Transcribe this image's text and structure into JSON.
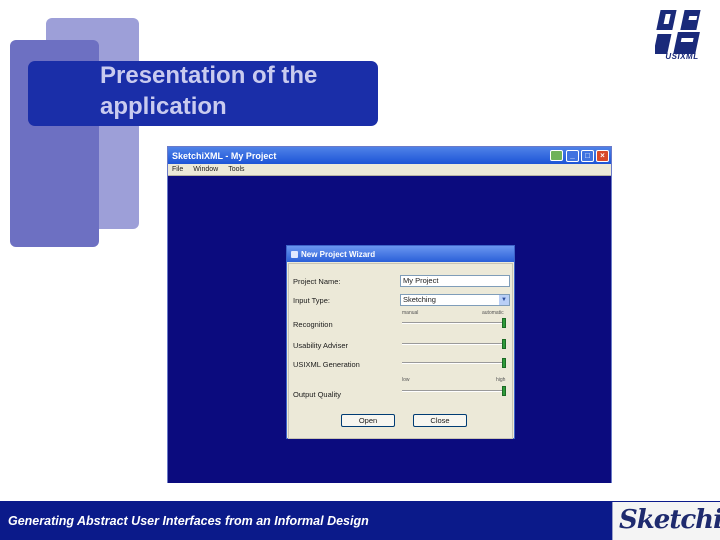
{
  "slide": {
    "title": "Presentation of the application",
    "footer": "Generating Abstract User Interfaces from an Informal Design",
    "logo_top_text": "USIXML",
    "logo_bottom_text": "Sketchi",
    "colors": {
      "title_band": "#1a2ea8",
      "footer": "#0b1a8a",
      "canvas": "#0b0b7e"
    }
  },
  "app": {
    "window_title": "SketchiXML - My Project",
    "menu": [
      "File",
      "Window",
      "Tools"
    ]
  },
  "wizard": {
    "title": "New Project Wizard",
    "fields": {
      "project_name_label": "Project Name:",
      "project_name_value": "My Project",
      "input_type_label": "Input Type:",
      "input_type_value": "Sketching",
      "recognition_label": "Recognition",
      "usability_label": "Usability Adviser",
      "usixml_label": "USIXML Generation",
      "output_label": "Output Quality"
    },
    "slider_ticks": {
      "manual": "manual",
      "automatic": "automatic",
      "low": "low",
      "high": "high"
    },
    "sliders": {
      "recognition": 1.0,
      "usability": 1.0,
      "usixml": 1.0,
      "output_quality": 1.0
    },
    "buttons": {
      "ok": "Open",
      "cancel": "Close"
    }
  }
}
